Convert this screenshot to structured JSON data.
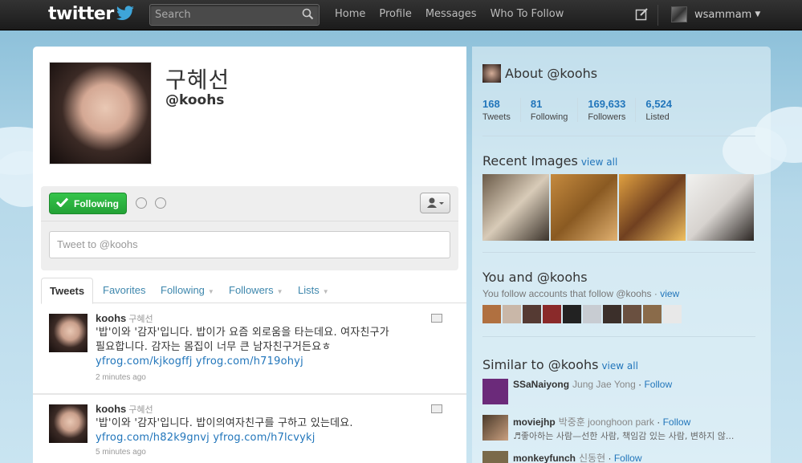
{
  "topbar": {
    "logo": "twitter",
    "search_placeholder": "Search",
    "nav": [
      "Home",
      "Profile",
      "Messages",
      "Who To Follow"
    ],
    "username": "wsammam"
  },
  "profile": {
    "display_name": "구혜선",
    "handle": "@koohs",
    "follow_button": "Following",
    "tweet_placeholder": "Tweet to @koohs"
  },
  "tabs": {
    "tweets": "Tweets",
    "favorites": "Favorites",
    "following": "Following",
    "followers": "Followers",
    "lists": "Lists"
  },
  "tweets": [
    {
      "username": "koohs",
      "name": "구혜선",
      "line1": "'밥'이와 '감자'입니다. 밥이가 요즘 외로움을 타는데요. 여자친구가",
      "line2": "필요합니다. 감자는 몸집이 너무 큰 남자친구거든요ㅎ",
      "links": "yfrog.com/kjkogffj yfrog.com/h719ohyj",
      "time": "2 minutes ago"
    },
    {
      "username": "koohs",
      "name": "구혜선",
      "line1": "'밥'이와 '감자'입니다. 밥이의여자친구를 구하고 있는데요.",
      "links": "yfrog.com/h82k9gnvj yfrog.com/h7lcvykj",
      "time": "5 minutes ago"
    }
  ],
  "dashboard": {
    "about_title": "About @koohs",
    "stats": [
      {
        "num": "168",
        "label": "Tweets"
      },
      {
        "num": "81",
        "label": "Following"
      },
      {
        "num": "169,633",
        "label": "Followers"
      },
      {
        "num": "6,524",
        "label": "Listed"
      }
    ],
    "recent_images_title": "Recent Images",
    "view_all": "view all",
    "you_and_title": "You and @koohs",
    "you_follow_text": "You follow accounts that follow @koohs ·",
    "view": "view",
    "similar_title": "Similar to @koohs",
    "follow": "Follow",
    "similar": [
      {
        "screen": "SSaNaiyong",
        "name": "Jung Jae Yong",
        "bio": ""
      },
      {
        "screen": "moviejhp",
        "name": "박중훈 joonghoon park",
        "bio": "♬좋아하는 사람—선한 사람, 책임감 있는 사람, 변하지 않..."
      },
      {
        "screen": "monkeyfunch",
        "name": "신동현",
        "bio": ""
      }
    ]
  },
  "colors": {
    "link": "#2276bb",
    "follow_green": "#2fb843",
    "topbar": "#1f1f1f"
  }
}
